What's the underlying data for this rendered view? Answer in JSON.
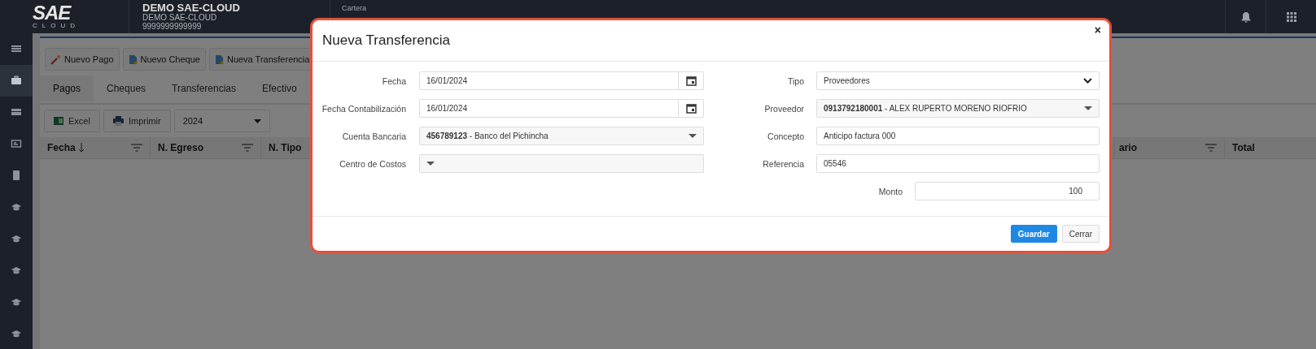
{
  "header": {
    "logo": {
      "main": "SAE",
      "sub": "CLOUD"
    },
    "company": {
      "name": "DEMO SAE-CLOUD",
      "subname": "DEMO SAE-CLOUD",
      "ruc": "9999999999999"
    },
    "module": "Cartera"
  },
  "sidebar": {
    "items": [
      {
        "kind": "list",
        "selected": false
      },
      {
        "kind": "briefcase",
        "selected": true
      },
      {
        "kind": "card",
        "selected": false
      },
      {
        "kind": "id",
        "selected": false
      },
      {
        "kind": "book",
        "selected": false
      },
      {
        "kind": "cap",
        "selected": false
      },
      {
        "kind": "cap",
        "selected": false
      },
      {
        "kind": "cap",
        "selected": false
      },
      {
        "kind": "cap",
        "selected": false
      },
      {
        "kind": "cap",
        "selected": false
      }
    ]
  },
  "actions": [
    {
      "label": "Nuevo Pago",
      "kind": "wand"
    },
    {
      "label": "Nuevo Cheque",
      "kind": "doc"
    },
    {
      "label": "Nueva Transferencia",
      "kind": "doc"
    }
  ],
  "tabs": [
    {
      "label": "Pagos",
      "selected": true
    },
    {
      "label": "Cheques",
      "selected": false
    },
    {
      "label": "Transferencias",
      "selected": false
    },
    {
      "label": "Efectivo",
      "selected": false
    }
  ],
  "toolbar": {
    "buttons": [
      {
        "label": "Excel",
        "kind": "excel"
      },
      {
        "label": "Imprimir",
        "kind": "print"
      }
    ],
    "year": "2024"
  },
  "table": {
    "columns": [
      {
        "label": "Fecha",
        "sorted": true,
        "filter": true
      },
      {
        "label": "N. Egreso",
        "sorted": false,
        "filter": true
      },
      {
        "label": "N. Tipo",
        "sorted": false
      },
      {
        "label": "ario",
        "sorted": false,
        "filter": true
      },
      {
        "label": "Total",
        "sorted": false,
        "filter": false
      }
    ]
  },
  "dialog": {
    "title": "Nueva Transferencia",
    "close": "×",
    "left_fields": [
      {
        "label": "Fecha",
        "kind": "date",
        "value": "16/01/2024"
      },
      {
        "label": "Fecha Contabilización",
        "kind": "date",
        "value": "16/01/2024"
      },
      {
        "label": "Cuenta Bancaria",
        "kind": "combo",
        "value": "**456789123** - Banco del Pichincha"
      },
      {
        "label": "Centro de Costos",
        "kind": "combo"
      }
    ],
    "right_fields": [
      {
        "label": "Tipo",
        "kind": "select",
        "value": "Proveedores"
      },
      {
        "label": "Proveedor",
        "kind": "combo",
        "value": "**0913792180001** - ALEX RUPERTO MORENO RIOFRIO"
      },
      {
        "label": "Concepto",
        "kind": "text",
        "value": "Anticipo factura 000"
      },
      {
        "label": "Referencia",
        "kind": "text",
        "value": "05546"
      }
    ],
    "amount": {
      "label": "Monto",
      "value": "100"
    },
    "buttons": [
      {
        "label": "Guardar",
        "kind": "primary"
      },
      {
        "label": "Cerrar",
        "kind": "default"
      }
    ]
  }
}
